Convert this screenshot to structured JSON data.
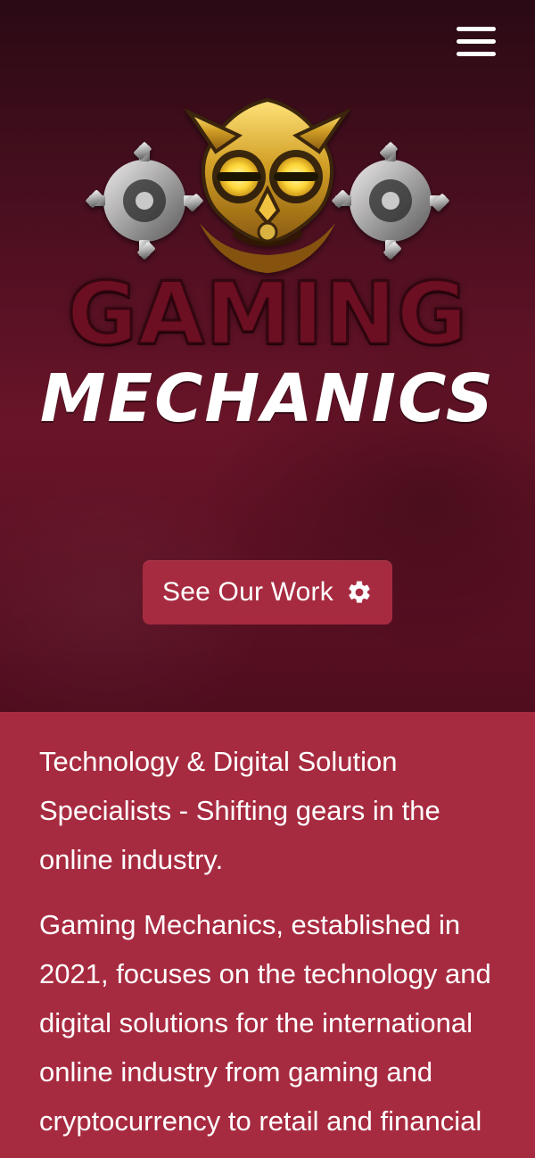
{
  "header": {
    "menu_icon": "hamburger-menu-icon"
  },
  "hero": {
    "brand_top": "GAMING",
    "brand_bottom": "MECHANICS",
    "cta": {
      "label": "See Our Work",
      "icon": "gear-icon"
    }
  },
  "content": {
    "intro": "Technology & Digital Solution Specialists - Shifting gears in the online industry.",
    "body": "Gaming Mechanics, established in 2021, focuses on the technology and digital solutions for the international online industry from gaming and cryptocurrency to retail and financial"
  },
  "colors": {
    "accent": "#a72b40",
    "hero_dark": "#2a0a14",
    "brand_red": "#6d0f22",
    "text": "#ffffff"
  }
}
